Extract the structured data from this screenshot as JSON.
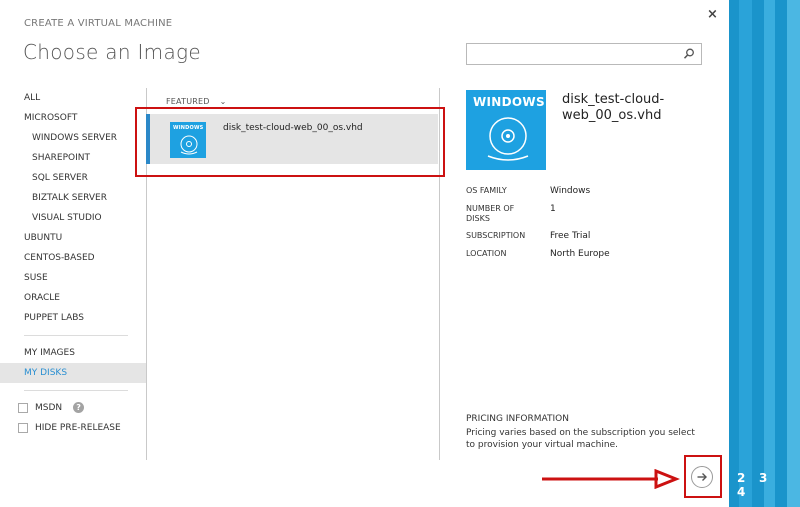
{
  "header": {
    "wizard_title": "CREATE A VIRTUAL MACHINE",
    "page_title": "Choose an Image",
    "close_label": "×"
  },
  "search": {
    "placeholder": "",
    "value": ""
  },
  "sidebar": {
    "categories": [
      {
        "label": "ALL"
      },
      {
        "label": "MICROSOFT"
      },
      {
        "label": "WINDOWS SERVER"
      },
      {
        "label": "SHAREPOINT"
      },
      {
        "label": "SQL SERVER"
      },
      {
        "label": "BIZTALK SERVER"
      },
      {
        "label": "VISUAL STUDIO"
      },
      {
        "label": "UBUNTU"
      },
      {
        "label": "CENTOS-BASED"
      },
      {
        "label": "SUSE"
      },
      {
        "label": "ORACLE"
      },
      {
        "label": "PUPPET LABS"
      }
    ],
    "my_items": [
      {
        "label": "MY IMAGES"
      },
      {
        "label": "MY DISKS",
        "selected": true
      }
    ],
    "filters": [
      {
        "label": "MSDN",
        "checked": false
      },
      {
        "label": "HIDE PRE-RELEASE",
        "checked": false
      }
    ]
  },
  "list": {
    "sort_label": "FEATURED",
    "items": [
      {
        "name": "disk_test-cloud-web_00_os.vhd",
        "tile_label": "WINDOWS",
        "selected": true
      }
    ]
  },
  "details": {
    "tile_label": "WINDOWS",
    "name": "disk_test-cloud-web_00_os.vhd",
    "properties": [
      {
        "key": "OS FAMILY",
        "value": "Windows"
      },
      {
        "key": "NUMBER OF DISKS",
        "value": "1"
      },
      {
        "key": "SUBSCRIPTION",
        "value": "Free Trial"
      },
      {
        "key": "LOCATION",
        "value": "North Europe"
      }
    ],
    "pricing_title": "PRICING INFORMATION",
    "pricing_text": "Pricing varies based on the subscription you select to provision your virtual machine."
  },
  "wizard": {
    "steps": [
      "2",
      "3",
      "4"
    ]
  },
  "colors": {
    "accent": "#1ea1e1",
    "panel": "#1a94cb",
    "highlight": "#cc1111",
    "selection": "#2b88c8"
  },
  "icons": {
    "close": "close-icon",
    "search": "search-icon",
    "disk": "disk-icon",
    "next": "arrow-right-icon"
  }
}
